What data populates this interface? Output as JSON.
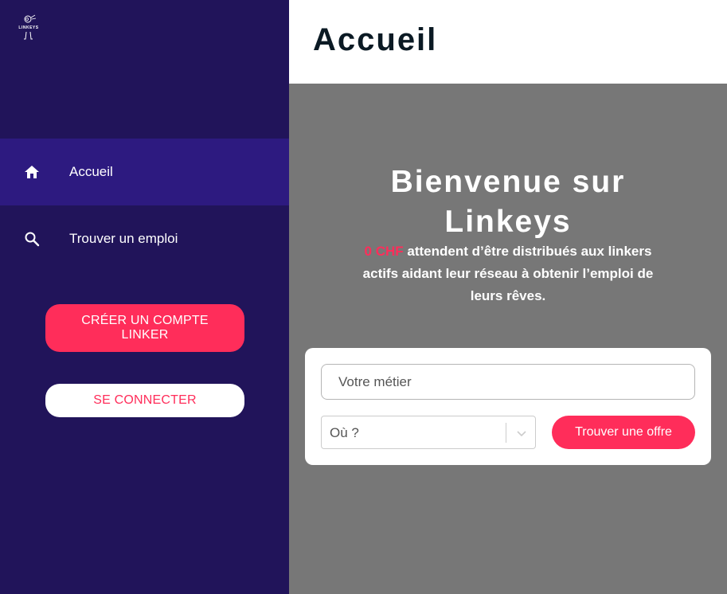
{
  "sidebar": {
    "logo_text": "LINKEYS",
    "items": [
      {
        "label": "Accueil",
        "icon": "home-icon",
        "active": true
      },
      {
        "label": "Trouver un emploi",
        "icon": "search-icon",
        "active": false
      }
    ],
    "create_account_label": "CRÉER UN COMPTE LINKER",
    "login_label": "SE CONNECTER"
  },
  "header": {
    "title": "Accueil"
  },
  "hero": {
    "title": "Bienvenue sur Linkeys",
    "amount": "0 CHF",
    "description": " attendent d’être distribués aux linkers actifs aidant leur réseau à obtenir l’emploi de leurs rêves."
  },
  "search": {
    "job_placeholder": "Votre métier",
    "job_value": "",
    "location_placeholder": "Où ?",
    "submit_label": "Trouver une offre"
  },
  "colors": {
    "sidebar_bg": "#21145a",
    "active_item_bg": "#2d1a80",
    "accent": "#ff2d5a",
    "content_bg": "#777777"
  }
}
